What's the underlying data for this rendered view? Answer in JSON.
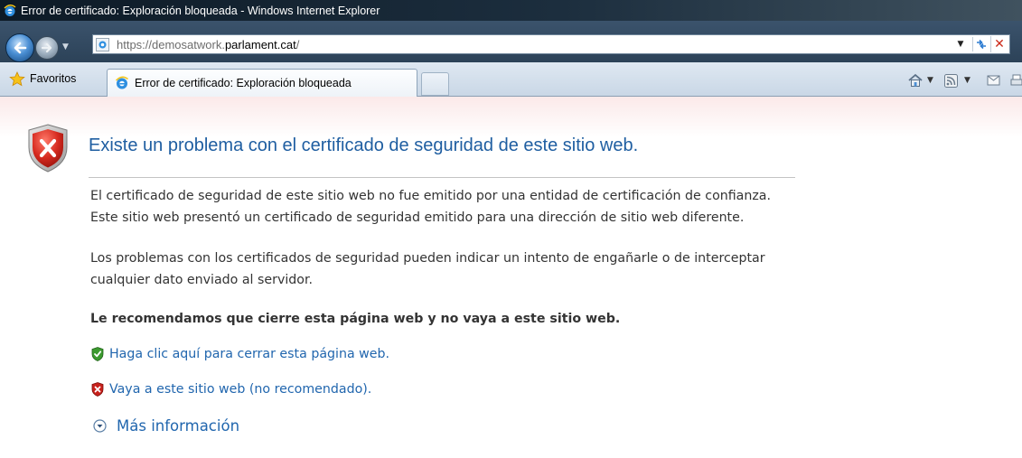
{
  "window": {
    "title": "Error de certificado: Exploración bloqueada - Windows Internet Explorer"
  },
  "address_bar": {
    "url_prefix": "https://demosatwork.",
    "url_domain": "parlament.cat",
    "url_suffix": "/"
  },
  "favorites_bar": {
    "favorites_label": "Favoritos",
    "tabs": [
      {
        "label": "Error de certificado: Exploración bloqueada",
        "active": true
      }
    ]
  },
  "page": {
    "heading": "Existe un problema con el certificado de seguridad de este sitio web.",
    "paragraph1": [
      "El certificado de seguridad de este sitio web no fue emitido por una entidad de certificación de confianza.",
      "Este sitio web presentó un certificado de seguridad emitido para una dirección de sitio web diferente."
    ],
    "paragraph2": [
      "Los problemas con los certificados de seguridad pueden indicar un intento de engañarle o de interceptar",
      "cualquier dato enviado al servidor."
    ],
    "recommendation": "Le recomendamos que cierre esta página web y no vaya a este sitio web.",
    "close_link": "Haga clic aquí para cerrar esta página web.",
    "continue_link": "Vaya a este sitio web (no recomendado).",
    "more_info": "Más información"
  },
  "colors": {
    "heading": "#1f5ea1",
    "link": "#2166ae",
    "body_text": "#333333",
    "error_shield": "#c8211c",
    "safe_shield": "#3c9a2f"
  },
  "icons": [
    "ie-logo-icon",
    "back-arrow-icon",
    "forward-arrow-icon",
    "page-icon",
    "refresh-icon",
    "stop-icon",
    "favorites-star-icon",
    "home-icon",
    "rss-feed-icon",
    "mail-icon",
    "error-shield-icon",
    "green-shield-icon",
    "red-shield-icon",
    "expand-circle-icon"
  ]
}
